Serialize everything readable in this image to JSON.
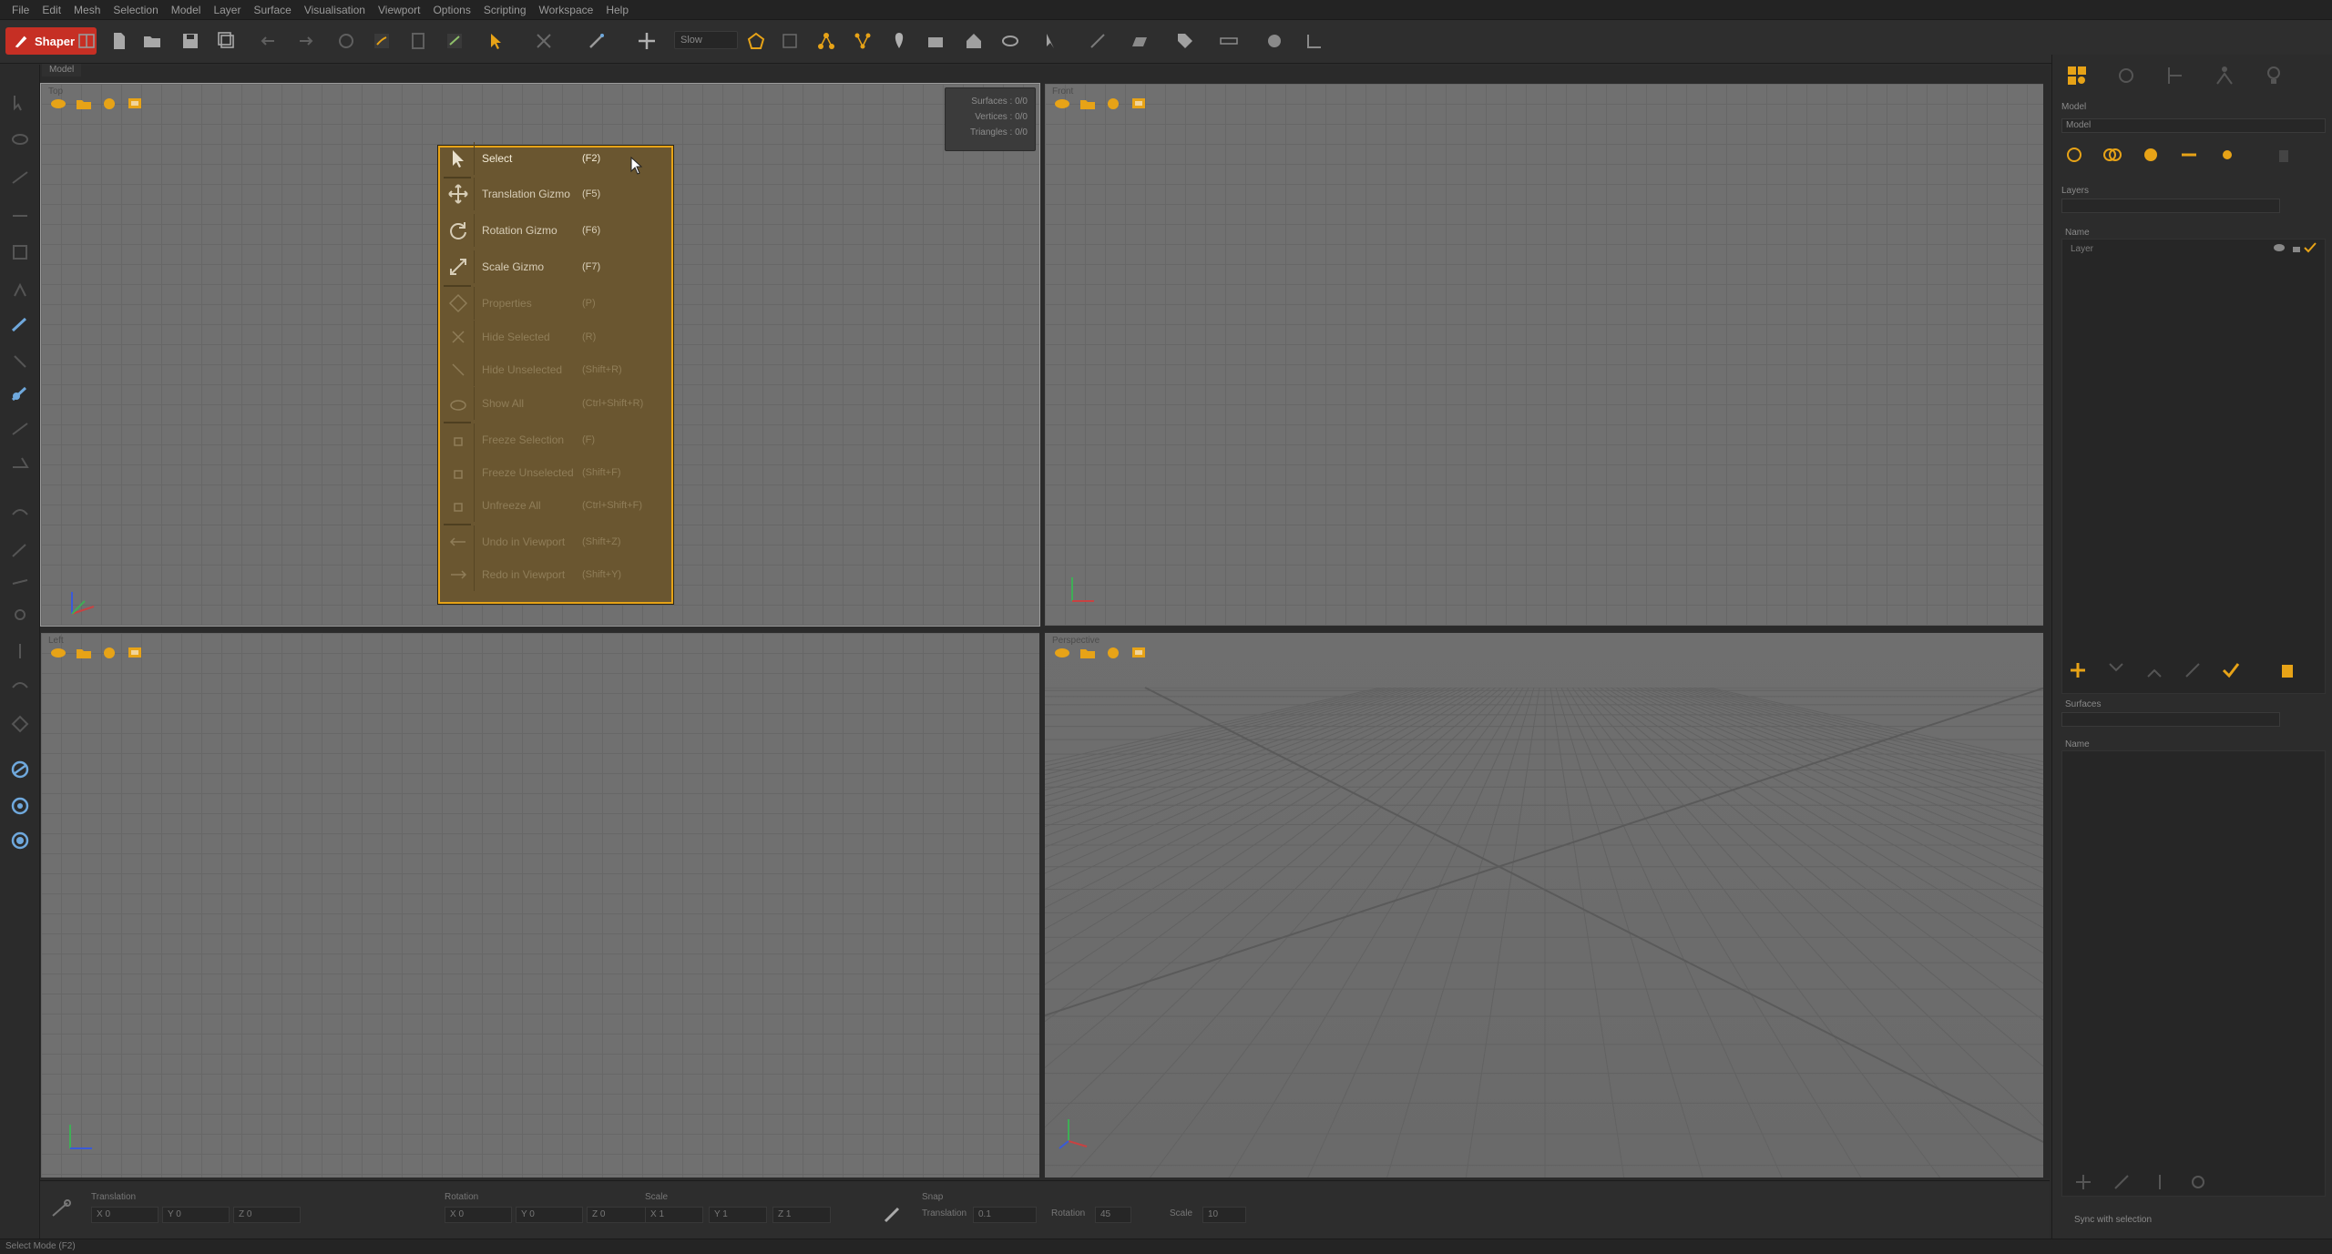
{
  "menubar": [
    "File",
    "Edit",
    "Mesh",
    "Selection",
    "Model",
    "Layer",
    "Surface",
    "Visualisation",
    "Viewport",
    "Options",
    "Scripting",
    "Workspace",
    "Help"
  ],
  "app": {
    "logo": "Shaper"
  },
  "toolbar": {
    "mode_value": "Slow"
  },
  "viewport_tab": "Model",
  "viewports": [
    {
      "name": "Top"
    },
    {
      "name": "Front"
    },
    {
      "name": "Left"
    },
    {
      "name": "Perspective"
    }
  ],
  "stats": {
    "surfaces": "Surfaces : 0/0",
    "vertices": "Vertices : 0/0",
    "triangles": "Triangles : 0/0"
  },
  "context_menu": [
    {
      "label": "Select",
      "shortcut": "(F2)",
      "state": "first",
      "icon": "cursor-arrow-icon"
    },
    {
      "label": "Translation Gizmo",
      "shortcut": "(F5)",
      "state": "enabled",
      "icon": "move-arrows-icon"
    },
    {
      "label": "Rotation Gizmo",
      "shortcut": "(F6)",
      "state": "enabled",
      "icon": "rotate-icon"
    },
    {
      "label": "Scale Gizmo",
      "shortcut": "(F7)",
      "state": "enabled",
      "icon": "scale-icon"
    },
    {
      "label": "Properties",
      "shortcut": "(P)",
      "state": "disabled",
      "icon": "properties-icon"
    },
    {
      "label": "Hide Selected",
      "shortcut": "(R)",
      "state": "disabled",
      "icon": "hide-selected-icon"
    },
    {
      "label": "Hide Unselected",
      "shortcut": "(Shift+R)",
      "state": "disabled",
      "icon": "hide-unselected-icon"
    },
    {
      "label": "Show All",
      "shortcut": "(Ctrl+Shift+R)",
      "state": "disabled",
      "icon": "show-all-icon"
    },
    {
      "label": "Freeze Selection",
      "shortcut": "(F)",
      "state": "disabled",
      "icon": "freeze-icon"
    },
    {
      "label": "Freeze Unselected",
      "shortcut": "(Shift+F)",
      "state": "disabled",
      "icon": "freeze-unselected-icon"
    },
    {
      "label": "Unfreeze All",
      "shortcut": "(Ctrl+Shift+F)",
      "state": "disabled",
      "icon": "unfreeze-icon"
    },
    {
      "label": "Undo in Viewport",
      "shortcut": "(Shift+Z)",
      "state": "disabled",
      "icon": "undo-icon"
    },
    {
      "label": "Redo in Viewport",
      "shortcut": "(Shift+Y)",
      "state": "disabled",
      "icon": "redo-icon"
    }
  ],
  "right_panel": {
    "model_label": "Model",
    "model_select": "Model",
    "layers_label": "Layers",
    "layers_name_header": "Name",
    "layer_name": "Layer",
    "surfaces_label": "Surfaces",
    "surfaces_name_header": "Name",
    "sync_label": "Sync with selection"
  },
  "bottom": {
    "translation_label": "Translation",
    "rotation_label": "Rotation",
    "scale_label": "Scale",
    "snap_label": "Snap",
    "snap_translation": "Translation",
    "snap_rotation": "Rotation",
    "snap_scale": "Scale",
    "translation_values": [
      "X  0",
      "Y  0",
      "Z  0"
    ],
    "rotation_values": [
      "X  0",
      "Y  0",
      "Z  0"
    ],
    "scale_values": [
      "X  1",
      "Y  1",
      "Z  1"
    ],
    "snap_translation_value": "0.1",
    "snap_rotation_value": "45",
    "snap_scale_value": "10"
  },
  "status": "Select Mode (F2)",
  "colors": {
    "accent": "#e7a317",
    "menu_bg": "#6a5630",
    "viewport": "#707070"
  }
}
